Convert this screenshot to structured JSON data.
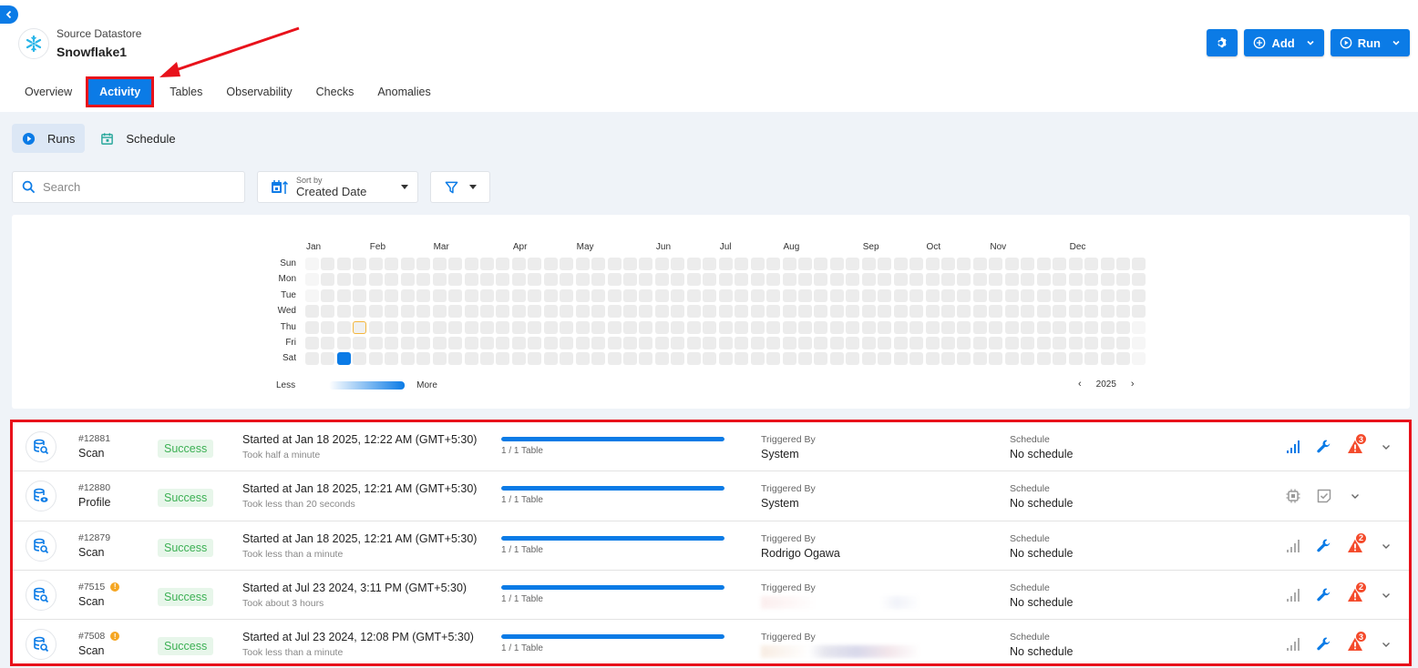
{
  "header": {
    "subtitle": "Source Datastore",
    "title": "Snowflake1"
  },
  "actions": {
    "add_label": "Add",
    "run_label": "Run"
  },
  "tabs": [
    {
      "label": "Overview",
      "active": false
    },
    {
      "label": "Activity",
      "active": true
    },
    {
      "label": "Tables",
      "active": false
    },
    {
      "label": "Observability",
      "active": false
    },
    {
      "label": "Checks",
      "active": false
    },
    {
      "label": "Anomalies",
      "active": false
    }
  ],
  "subtabs": [
    {
      "label": "Runs",
      "active": true
    },
    {
      "label": "Schedule",
      "active": false
    }
  ],
  "filters": {
    "search_placeholder": "Search",
    "search_value": "",
    "sort_label": "Sort by",
    "sort_value": "Created Date"
  },
  "heatmap": {
    "year": "2025",
    "months": [
      "Jan",
      "Feb",
      "Mar",
      "Apr",
      "May",
      "Jun",
      "Jul",
      "Aug",
      "Sep",
      "Oct",
      "Nov",
      "Dec"
    ],
    "days": [
      "Sun",
      "Mon",
      "Tue",
      "Wed",
      "Thu",
      "Fri",
      "Sat"
    ],
    "legend_less": "Less",
    "legend_more": "More",
    "activity_dates": [
      "2025-01-18"
    ],
    "today": "2025-01-23",
    "colors": {
      "active": "#0b7be6",
      "today_outline": "#f4b63c",
      "empty": "#ececec"
    }
  },
  "runs": [
    {
      "id": "#12881",
      "type": "Scan",
      "icon": "scan-icon",
      "warning": false,
      "status": "Success",
      "started": "Started at Jan 18 2025, 12:22 AM (GMT+5:30)",
      "duration": "Took half a minute",
      "progress": 1.0,
      "progress_label": "1 / 1 Table",
      "triggered_label": "Triggered By",
      "triggered_by": "System",
      "triggered_redacted": false,
      "schedule_label": "Schedule",
      "schedule": "No schedule",
      "action_set": "scan",
      "signal_active": true,
      "anomaly_count": "3"
    },
    {
      "id": "#12880",
      "type": "Profile",
      "icon": "profile-icon",
      "warning": false,
      "status": "Success",
      "started": "Started at Jan 18 2025, 12:21 AM (GMT+5:30)",
      "duration": "Took less than 20 seconds",
      "progress": 1.0,
      "progress_label": "1 / 1 Table",
      "triggered_label": "Triggered By",
      "triggered_by": "System",
      "triggered_redacted": false,
      "schedule_label": "Schedule",
      "schedule": "No schedule",
      "action_set": "profile",
      "signal_active": false,
      "anomaly_count": ""
    },
    {
      "id": "#12879",
      "type": "Scan",
      "icon": "scan-icon",
      "warning": false,
      "status": "Success",
      "started": "Started at Jan 18 2025, 12:21 AM (GMT+5:30)",
      "duration": "Took less than a minute",
      "progress": 1.0,
      "progress_label": "1 / 1 Table",
      "triggered_label": "Triggered By",
      "triggered_by": "Rodrigo Ogawa",
      "triggered_redacted": false,
      "schedule_label": "Schedule",
      "schedule": "No schedule",
      "action_set": "scan",
      "signal_active": false,
      "anomaly_count": "2"
    },
    {
      "id": "#7515",
      "type": "Scan",
      "icon": "scan-icon",
      "warning": true,
      "status": "Success",
      "started": "Started at Jul 23 2024, 3:11 PM (GMT+5:30)",
      "duration": "Took about 3 hours",
      "progress": 1.0,
      "progress_label": "1 / 1 Table",
      "triggered_label": "Triggered By",
      "triggered_by": "",
      "triggered_redacted": true,
      "schedule_label": "Schedule",
      "schedule": "No schedule",
      "action_set": "scan",
      "signal_active": false,
      "anomaly_count": "2"
    },
    {
      "id": "#7508",
      "type": "Scan",
      "icon": "scan-icon",
      "warning": true,
      "status": "Success",
      "started": "Started at Jul 23 2024, 12:08 PM (GMT+5:30)",
      "duration": "Took less than a minute",
      "progress": 1.0,
      "progress_label": "1 / 1 Table",
      "triggered_label": "Triggered By",
      "triggered_by": "",
      "triggered_redacted": true,
      "schedule_label": "Schedule",
      "schedule": "No schedule",
      "action_set": "scan",
      "signal_active": false,
      "anomaly_count": "3"
    }
  ],
  "colors": {
    "accent": "#0b7be6",
    "success_bg": "#e7f6ea",
    "success_text": "#3cb054",
    "anomaly": "#f44b2c",
    "highlight": "#e8121b"
  }
}
